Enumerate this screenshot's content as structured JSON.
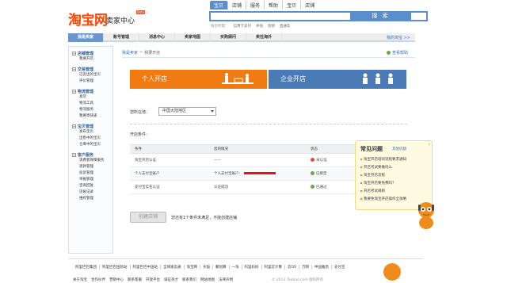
{
  "header": {
    "logo": "淘宝网",
    "logo_sub": "卖家中心",
    "logo_badge": "Beta",
    "search_tabs": [
      "宝贝",
      "店铺",
      "服务",
      "帮助",
      "宝贝",
      "店铺"
    ],
    "search_tabs_active": 0,
    "search_button": "搜 索",
    "search_placeholder": "",
    "hot_label": "搜您所需：",
    "hot_links": [
      "信用卡支付",
      "评估",
      "装修",
      "直通车"
    ]
  },
  "nav": {
    "items": [
      "我是卖家",
      "账号管理",
      "消息中心",
      "卖家地图",
      "买购顾问",
      "卖往海外"
    ],
    "active": 0,
    "help_link": "我的淘宝 >>"
  },
  "sidebar": {
    "groups": [
      {
        "title": "店铺管理",
        "items": [
          "我要开店"
        ]
      },
      {
        "title": "交易管理",
        "items": [
          "已卖出的宝贝",
          "评价管理"
        ]
      },
      {
        "title": "物流管理",
        "items": [
          "发货",
          "物流工具",
          "物流服务",
          "我要寄快递"
        ]
      },
      {
        "title": "宝贝管理",
        "items": [
          "发布宝贝",
          "出售中的宝贝",
          "仓库中的宝贝"
        ]
      },
      {
        "title": "客户服务",
        "items": [
          "消费者保障服务",
          "退款管理",
          "投诉管理",
          "举报管理",
          "咨询回复",
          "违规记录",
          "维权管理"
        ]
      }
    ]
  },
  "main": {
    "breadcrumb": [
      "我是卖家",
      "我要开店"
    ],
    "view_help": "查看帮助",
    "banner_personal": "个人开店",
    "banner_company": "企业开店",
    "location_label": "您所在地：",
    "location_value": "中国大陆地区",
    "conditions_label": "开店条件：",
    "table": {
      "headers": [
        "条件",
        "您的情况",
        "状态",
        ""
      ],
      "rows": [
        {
          "condition": "淘宝开店认证",
          "status_text": "——",
          "state": "未认证",
          "ok": false
        },
        {
          "condition": "个人支付宝账户",
          "status_text": "个人支付宝账户：",
          "state": "已绑定",
          "ok": true
        },
        {
          "condition": "支付宝实名认证",
          "status_text": "认证成功",
          "state": "已通过",
          "ok": true
        }
      ]
    },
    "create_button": "创建店铺",
    "create_note": "您还有1个条件未满足，不能创建店铺"
  },
  "faq": {
    "title": "常见问题",
    "more": "其他问题",
    "close": "x",
    "items": [
      "淘宝开店培训流程要求通知",
      "开店考试要做吗么",
      "淘宝开店流程",
      "淘宝开店要免费吗？",
      "开店考试规则",
      "我要免淘宝开店操作全攻略"
    ]
  },
  "footer": {
    "links": [
      "阿里巴巴集团",
      "阿里巴巴国际站",
      "阿里巴巴中国站",
      "全球速卖通",
      "淘宝网",
      "天猫",
      "聚划算",
      "一淘",
      "阿里妈妈",
      "阿里云计算",
      "云OS",
      "万网",
      "中国雅虎",
      "支付宝"
    ],
    "bottom": [
      "关于淘宝",
      "合作伙伴",
      "营销中心",
      "联系客服",
      "开放平台",
      "诚征英才",
      "联系我们",
      "网站地图",
      "法律声明"
    ],
    "copyright": "© 2013 Taobao.com 版权所有"
  }
}
